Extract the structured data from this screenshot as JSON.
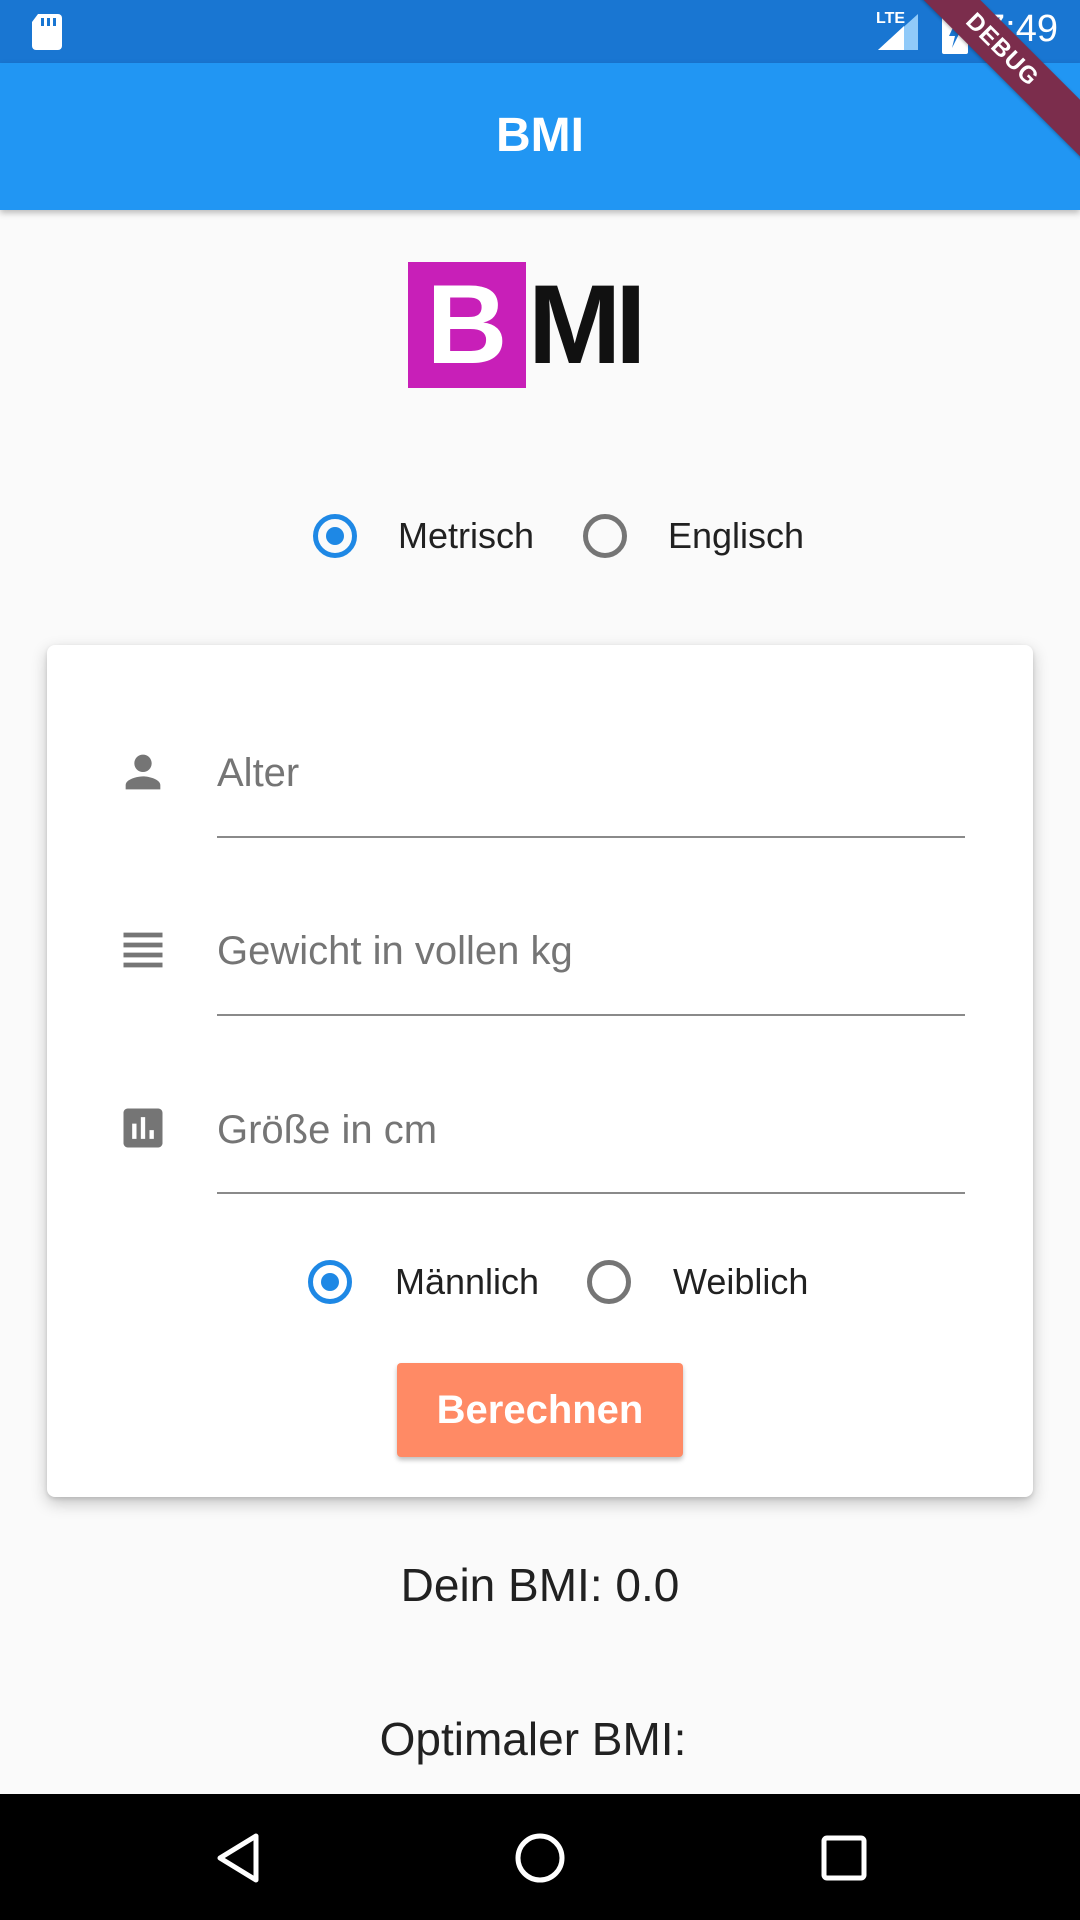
{
  "status_bar": {
    "network": "LTE",
    "time": "7:49"
  },
  "app_bar": {
    "title": "BMI",
    "debug_banner": "DEBUG"
  },
  "logo": {
    "letter_b": "B",
    "letters_mi": "MI",
    "colors": {
      "b_background": "#c81fb8",
      "mi_text": "#111111"
    }
  },
  "unit_system": {
    "options": [
      {
        "label": "Metrisch",
        "selected": true
      },
      {
        "label": "Englisch",
        "selected": false
      }
    ]
  },
  "form": {
    "fields": [
      {
        "icon": "person-icon",
        "placeholder": "Alter",
        "value": ""
      },
      {
        "icon": "weight-lines-icon",
        "placeholder": "Gewicht in vollen kg",
        "value": ""
      },
      {
        "icon": "bar-chart-icon",
        "placeholder": "Größe in cm",
        "value": ""
      }
    ],
    "gender": {
      "options": [
        {
          "label": "Männlich",
          "selected": true
        },
        {
          "label": "Weiblich",
          "selected": false
        }
      ]
    },
    "calculate_label": "Berechnen"
  },
  "results": {
    "bmi": "Dein BMI: 0.0",
    "optimal": "Optimaler BMI:"
  },
  "colors": {
    "app_bar": "#2196f3",
    "status_bar": "#1976d2",
    "accent": "#1e88e5",
    "button": "#ff8a65"
  },
  "nav_bar": {
    "icons": [
      "back-triangle-icon",
      "home-circle-icon",
      "recents-square-icon"
    ]
  }
}
